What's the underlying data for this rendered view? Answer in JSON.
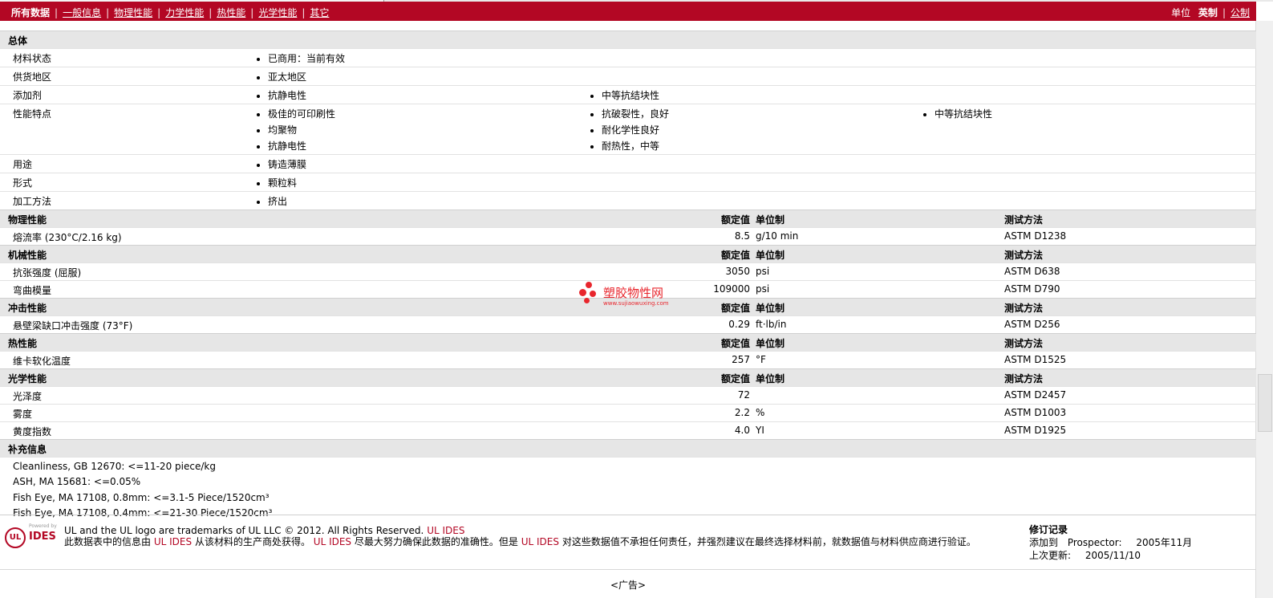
{
  "nav": {
    "tabs": [
      "所有数据",
      "一般信息",
      "物理性能",
      "力学性能",
      "热性能",
      "光学性能",
      "其它"
    ],
    "units_label": "单位",
    "unit_english": "英制",
    "unit_metric": "公制"
  },
  "overall": {
    "title": "总体",
    "rows": [
      {
        "label": "材料状态",
        "col1": [
          "已商用：当前有效"
        ],
        "col2": [],
        "col3": []
      },
      {
        "label": "供货地区",
        "col1": [
          "亚太地区"
        ],
        "col2": [],
        "col3": []
      },
      {
        "label": "添加剂",
        "col1": [
          "抗静电性"
        ],
        "col2": [
          "中等抗结块性"
        ],
        "col3": []
      },
      {
        "label": "性能特点",
        "col1": [
          "极佳的可印刷性",
          "均聚物",
          "抗静电性"
        ],
        "col2": [
          "抗破裂性，良好",
          "耐化学性良好",
          "耐热性，中等"
        ],
        "col3": [
          "中等抗结块性"
        ]
      },
      {
        "label": "用途",
        "col1": [
          "铸造薄膜"
        ],
        "col2": [],
        "col3": []
      },
      {
        "label": "形式",
        "col1": [
          "颗粒料"
        ],
        "col2": [],
        "col3": []
      },
      {
        "label": "加工方法",
        "col1": [
          "挤出"
        ],
        "col2": [],
        "col3": []
      }
    ]
  },
  "headers": {
    "nominal": "额定值",
    "unit": "单位制",
    "test": "测试方法"
  },
  "sections": [
    {
      "title": "物理性能",
      "rows": [
        {
          "label": "熔流率 (230°C/2.16 kg)",
          "value": "8.5",
          "unit": "g/10 min",
          "test": "ASTM D1238"
        }
      ]
    },
    {
      "title": "机械性能",
      "rows": [
        {
          "label": "抗张强度 (屈服)",
          "value": "3050",
          "unit": "psi",
          "test": "ASTM D638"
        },
        {
          "label": "弯曲模量",
          "value": "109000",
          "unit": "psi",
          "test": "ASTM D790"
        }
      ]
    },
    {
      "title": "冲击性能",
      "rows": [
        {
          "label": "悬壁梁缺口冲击强度 (73°F)",
          "value": "0.29",
          "unit": "ft·lb/in",
          "test": "ASTM D256"
        }
      ]
    },
    {
      "title": "热性能",
      "rows": [
        {
          "label": "维卡软化温度",
          "value": "257",
          "unit": "°F",
          "test": "ASTM D1525"
        }
      ]
    },
    {
      "title": "光学性能",
      "rows": [
        {
          "label": "光泽度",
          "value": "72",
          "unit": "",
          "test": "ASTM D2457"
        },
        {
          "label": "雾度",
          "value": "2.2",
          "unit": "%",
          "test": "ASTM D1003"
        },
        {
          "label": "黄度指数",
          "value": "4.0",
          "unit": "YI",
          "test": "ASTM D1925"
        }
      ]
    }
  ],
  "supplement": {
    "title": "补充信息",
    "notes": [
      "Cleanliness, GB 12670: <=11-20 piece/kg",
      "ASH, MA 15681: <=0.05%",
      "Fish Eye, MA 17108, 0.8mm: <=3.1-5 Piece/1520cm³",
      "Fish Eye, MA 17108, 0.4mm: <=21-30 Piece/1520cm³"
    ]
  },
  "footer": {
    "logo_powered": "Powered by",
    "logo_ul": "UL",
    "logo_ides": "IDES",
    "trademark": "UL and the UL logo are trademarks of UL LLC © 2012. All Rights Reserved.",
    "trademark_link": "UL IDES",
    "disclaimer_a": "此数据表中的信息由",
    "disclaimer_link1": "UL IDES",
    "disclaimer_b": "从该材料的生产商处获得。",
    "disclaimer_link2": "UL IDES",
    "disclaimer_c": "尽最大努力确保此数据的准确性。但是",
    "disclaimer_link3": "UL IDES",
    "disclaimer_d": "对这些数据值不承担任何责任，并强烈建议在最终选择材料前，就数据值与材料供应商进行验证。",
    "revision_title": "修订记录",
    "added_label": "添加到",
    "added_where": "Prospector:",
    "added_date": "2005年11月",
    "updated_label": "上次更新:",
    "updated_date": "2005/11/10"
  },
  "ad": "<广告>",
  "watermark": {
    "title": "塑胶物性网",
    "url": "www.sujiaowuxing.com"
  },
  "colors": {
    "brand_red": "#b30724",
    "section_gray": "#e6e6e6",
    "watermark_red": "#e8262d"
  }
}
